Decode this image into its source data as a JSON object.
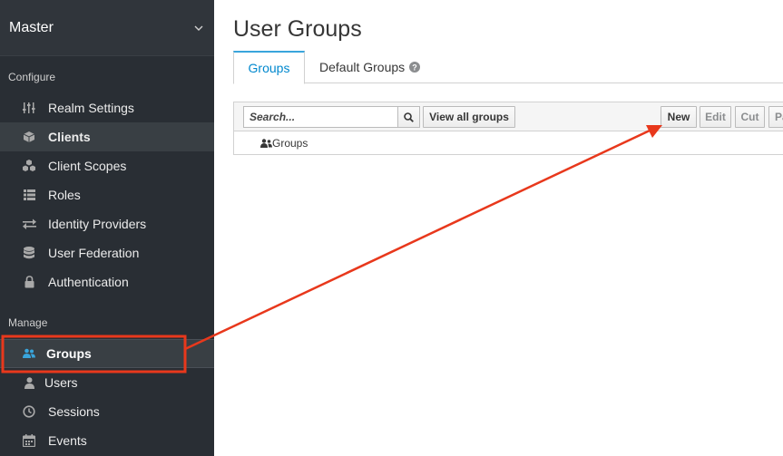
{
  "sidebar": {
    "realm": "Master",
    "configure_title": "Configure",
    "configure_items": [
      {
        "label": "Realm Settings",
        "icon": "sliders-icon"
      },
      {
        "label": "Clients",
        "icon": "cube-icon"
      },
      {
        "label": "Client Scopes",
        "icon": "cubes-icon"
      },
      {
        "label": "Roles",
        "icon": "list-icon"
      },
      {
        "label": "Identity Providers",
        "icon": "exchange-icon"
      },
      {
        "label": "User Federation",
        "icon": "database-icon"
      },
      {
        "label": "Authentication",
        "icon": "lock-icon"
      }
    ],
    "manage_title": "Manage",
    "manage_items": [
      {
        "label": "Groups",
        "icon": "users-icon"
      },
      {
        "label": "Users",
        "icon": "user-icon"
      },
      {
        "label": "Sessions",
        "icon": "clock-icon"
      },
      {
        "label": "Events",
        "icon": "calendar-icon"
      }
    ]
  },
  "main": {
    "title": "User Groups",
    "tabs": [
      {
        "label": "Groups"
      },
      {
        "label": "Default Groups"
      }
    ],
    "toolbar": {
      "search_placeholder": "Search...",
      "view_all": "View all groups",
      "new": "New",
      "edit": "Edit",
      "cut": "Cut",
      "paste": "Pa"
    },
    "tree": {
      "root_label": "Groups"
    }
  },
  "colors": {
    "sidebar_bg": "#292e34",
    "accent": "#39a5dc",
    "annotation": "#e8381c"
  }
}
